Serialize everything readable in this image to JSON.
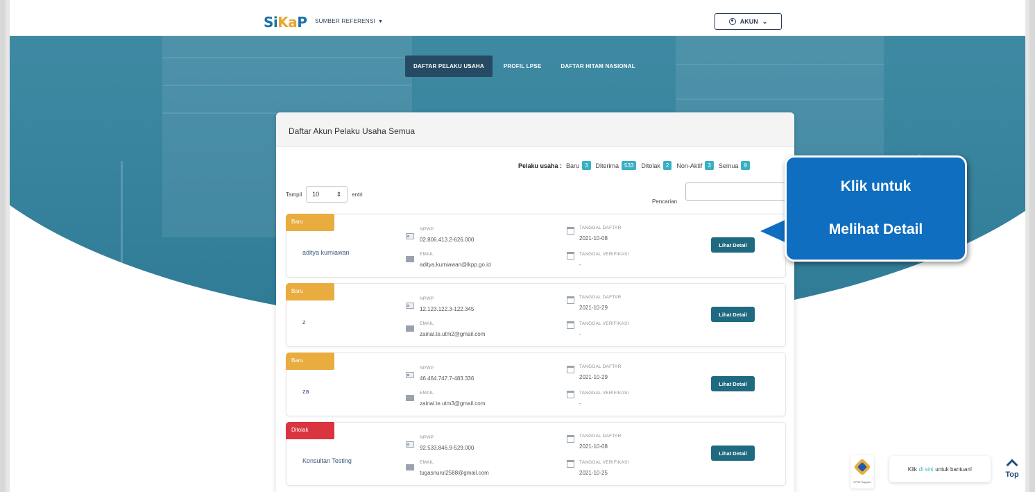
{
  "nav": {
    "logo_s": "Si",
    "logo_k": "Ka",
    "logo_p": "P",
    "menu_label": "SUMBER REFERENSI",
    "account_label": "AKUN"
  },
  "tabs": [
    {
      "label": "DAFTAR PELAKU USAHA",
      "active": true
    },
    {
      "label": "PROFIL LPSE",
      "active": false
    },
    {
      "label": "DAFTAR HITAM NASIONAL",
      "active": false
    }
  ],
  "card": {
    "title": "Daftar Akun Pelaku Usaha Semua",
    "stats_label": "Pelaku usaha :",
    "stats": [
      {
        "label": "Baru",
        "count": "3"
      },
      {
        "label": "Diterima",
        "count": "533"
      },
      {
        "label": "Ditolak",
        "count": "2"
      },
      {
        "label": "Non-Aktif",
        "count": "3"
      },
      {
        "label": "Semua",
        "count": "9"
      }
    ],
    "tampil_label": "Tampil",
    "tampil_value": "10",
    "entri_label": "entri",
    "search_label": "Pencarian",
    "search_value": ""
  },
  "field_labels": {
    "npwp": "NPWP",
    "email": "EMAIL",
    "tanggal_daftar": "TANGGAL DAFTAR",
    "tanggal_verifikasi": "TANGGAL VERIFIKASI"
  },
  "detail_button_label": "Lihat Detail",
  "items": [
    {
      "status": "Baru",
      "name": "aditya kurniawan",
      "npwp": "02.806.413.2-626.000",
      "email": "aditya.kurniawan@lkpp.go.id",
      "tanggal_daftar": "2021-10-08",
      "tanggal_verifikasi": "-"
    },
    {
      "status": "Baru",
      "name": "z",
      "npwp": "12.123.122.3-122.345",
      "email": "zainal.te.utm2@gmail.com",
      "tanggal_daftar": "2021-10-29",
      "tanggal_verifikasi": "-"
    },
    {
      "status": "Baru",
      "name": "za",
      "npwp": "46.464.747.7-483.336",
      "email": "zainal.te.utm3@gmail.com",
      "tanggal_daftar": "2021-10-29",
      "tanggal_verifikasi": "-"
    },
    {
      "status": "Ditolak",
      "name": "Konsultan Testing",
      "npwp": "92.533.846.9-529.000",
      "email": "tugasnurul2588@gmail.com",
      "tanggal_daftar": "2021-10-08",
      "tanggal_verifikasi": "2021-10-25"
    }
  ],
  "callout": {
    "line1": "Klik untuk",
    "line2": "Melihat Detail"
  },
  "support": {
    "caption": "LPSE Support",
    "help_pre": "Klik",
    "help_hl": "di sini",
    "help_post": "untuk bantuan!",
    "top_label": "Top"
  },
  "colors": {
    "primary": "#1f6a80",
    "badge_baru": "#e9ac3f",
    "badge_ditolak": "#d9343f",
    "count_badge": "#3ab0c3",
    "callout": "#0f6ec0"
  }
}
